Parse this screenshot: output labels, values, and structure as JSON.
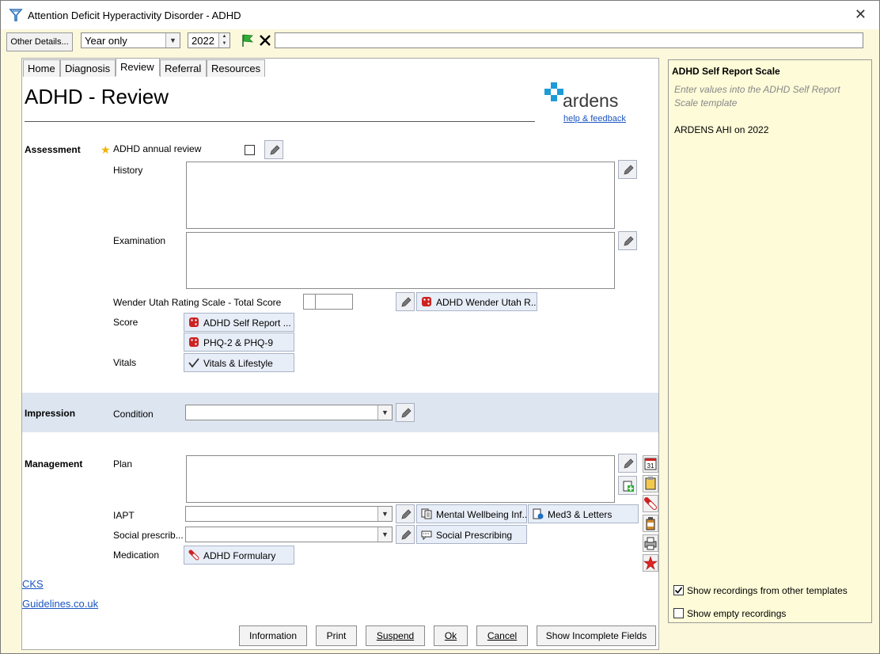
{
  "window": {
    "title": "Attention Deficit Hyperactivity Disorder - ADHD"
  },
  "toolbar": {
    "other_details": "Other Details...",
    "period_value": "Year only",
    "year_value": "2022",
    "search_value": ""
  },
  "tabs": [
    "Home",
    "Diagnosis",
    "Review",
    "Referral",
    "Resources"
  ],
  "page": {
    "title": "ADHD - Review",
    "logo_text": "ardens",
    "help_link": "help & feedback"
  },
  "assessment": {
    "section": "Assessment",
    "annual_review": "ADHD annual review",
    "history": "History",
    "examination": "Examination",
    "wender_label": "Wender Utah Rating Scale - Total Score",
    "wender_button": "ADHD Wender Utah R...",
    "score_label": "Score",
    "score_btn1": "ADHD Self Report ...",
    "score_btn2": "PHQ-2 & PHQ-9",
    "vitals_label": "Vitals",
    "vitals_btn": "Vitals & Lifestyle"
  },
  "impression": {
    "section": "Impression",
    "condition": "Condition"
  },
  "management": {
    "section": "Management",
    "plan": "Plan",
    "iapt": "IAPT",
    "iapt_btn1": "Mental Wellbeing Inf...",
    "iapt_btn2": "Med3 & Letters",
    "social": "Social prescrib...",
    "social_btn": "Social Prescribing",
    "medication": "Medication",
    "medication_btn": "ADHD Formulary"
  },
  "links": {
    "cks": "CKS",
    "guidelines": "Guidelines.co.uk"
  },
  "footer": {
    "information": "Information",
    "print": "Print",
    "suspend": "Suspend",
    "ok": "Ok",
    "cancel": "Cancel",
    "show_incomplete": "Show Incomplete Fields"
  },
  "right_panel": {
    "title": "ADHD Self Report Scale",
    "hint": "Enter values into the ADHD Self Report Scale template",
    "entry": "ARDENS AHI on 2022",
    "show_other": "Show recordings from other templates",
    "show_other_checked": true,
    "show_empty": "Show empty recordings",
    "show_empty_checked": false
  },
  "colors": {
    "panel_yellow": "#fdfbd8",
    "band_blue": "#dde5f0",
    "link_blue": "#1a55c0",
    "logo_blue": "#1e9bd7"
  },
  "calendar_icon_text": "31"
}
